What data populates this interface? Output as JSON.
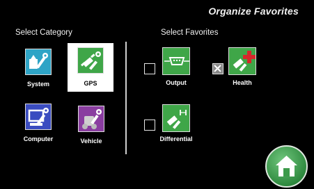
{
  "header": {
    "title": "Organize Favorites"
  },
  "category": {
    "label": "Select Category",
    "items": [
      {
        "label": "System",
        "icon": "system-icon",
        "color": "#2ea4c6",
        "selected": false
      },
      {
        "label": "GPS",
        "icon": "gps-icon",
        "color": "#3fa648",
        "selected": true
      },
      {
        "label": "Computer",
        "icon": "computer-icon",
        "color": "#3a4cc0",
        "selected": false
      },
      {
        "label": "Vehicle",
        "icon": "vehicle-icon",
        "color": "#8a3da0",
        "selected": false
      }
    ]
  },
  "favorites": {
    "label": "Select Favorites",
    "items": [
      {
        "label": "Output",
        "icon": "serial-port-icon",
        "checked": false
      },
      {
        "label": "Health",
        "icon": "health-icon",
        "checked": true
      },
      {
        "label": "Differential",
        "icon": "differential-icon",
        "checked": false
      }
    ]
  },
  "home": {
    "icon": "home-icon",
    "color": "#3c9a4a"
  }
}
